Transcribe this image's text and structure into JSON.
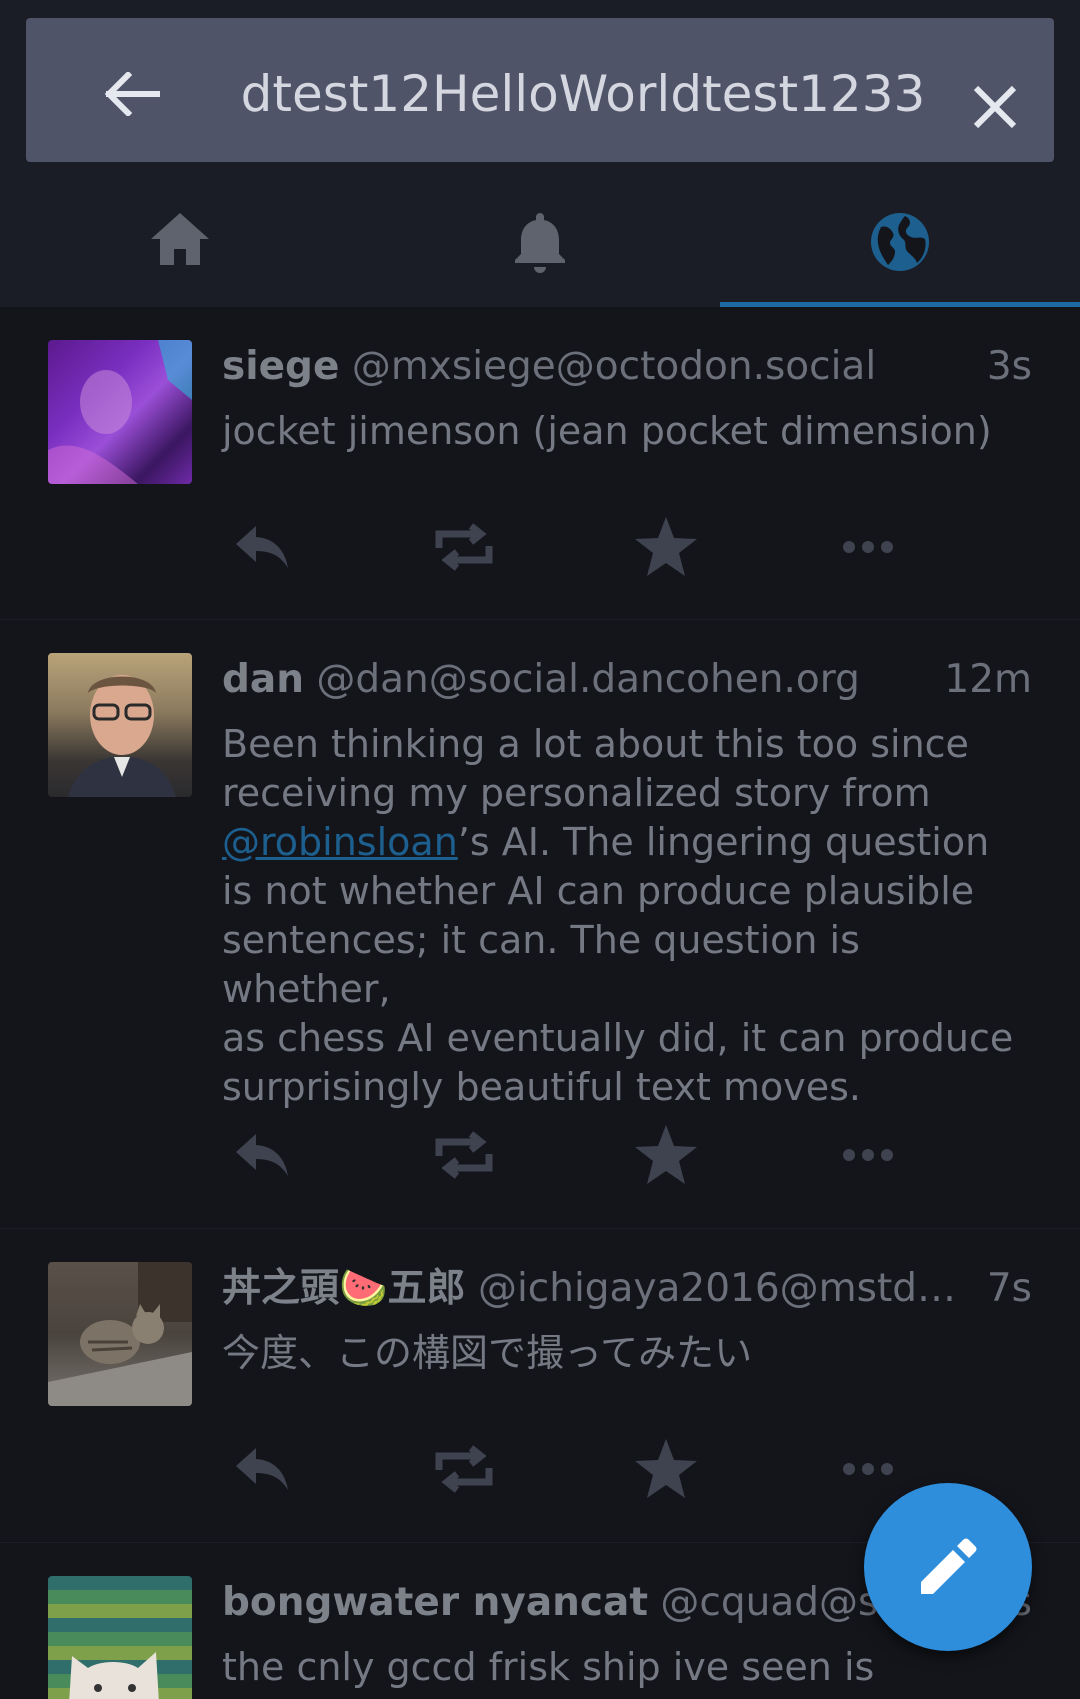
{
  "search": {
    "query": "dtest12HelloWorldtest1233"
  },
  "tabs": [
    {
      "name": "home",
      "icon": "home-icon",
      "active": false
    },
    {
      "name": "notifications",
      "icon": "bell-icon",
      "active": false
    },
    {
      "name": "federated",
      "icon": "globe-icon",
      "active": true
    }
  ],
  "colors": {
    "accent": "#2e8edc",
    "tab_indicator": "#1d6aa2",
    "background": "#13151b",
    "search_bar": "#4f5468"
  },
  "statuses": [
    {
      "display_name": "siege",
      "acct": "@mxsiege@octodon.social",
      "time": "3s",
      "content": "jocket jimenson (jean pocket dimension)"
    },
    {
      "display_name": "dan",
      "acct": "@dan@social.dancohen.org",
      "time": "12m",
      "content_lines": [
        "Been thinking a lot about this too since",
        "receiving my personalized story from",
        "’s AI. The lingering question",
        "is not whether AI can produce plausible",
        "sentences; it can. The question is whether,",
        "as chess AI eventually did, it can produce",
        "surprisingly beautiful text moves."
      ],
      "mention": "@robinsloan"
    },
    {
      "display_name": "丼之頭🍉五郎",
      "acct": "@ichigaya2016@mstdn.…",
      "time": "7s",
      "content": "今度、この構図で撮ってみたい"
    },
    {
      "display_name": "bongwater nyancat",
      "acct": "@cquad@skaia",
      "time": "s",
      "content": "the cnly gccd frisk ship ive seen is"
    }
  ],
  "action_icons": [
    "reply-icon",
    "boost-icon",
    "favourite-icon",
    "more-icon"
  ],
  "fab": {
    "icon": "pencil-icon"
  }
}
